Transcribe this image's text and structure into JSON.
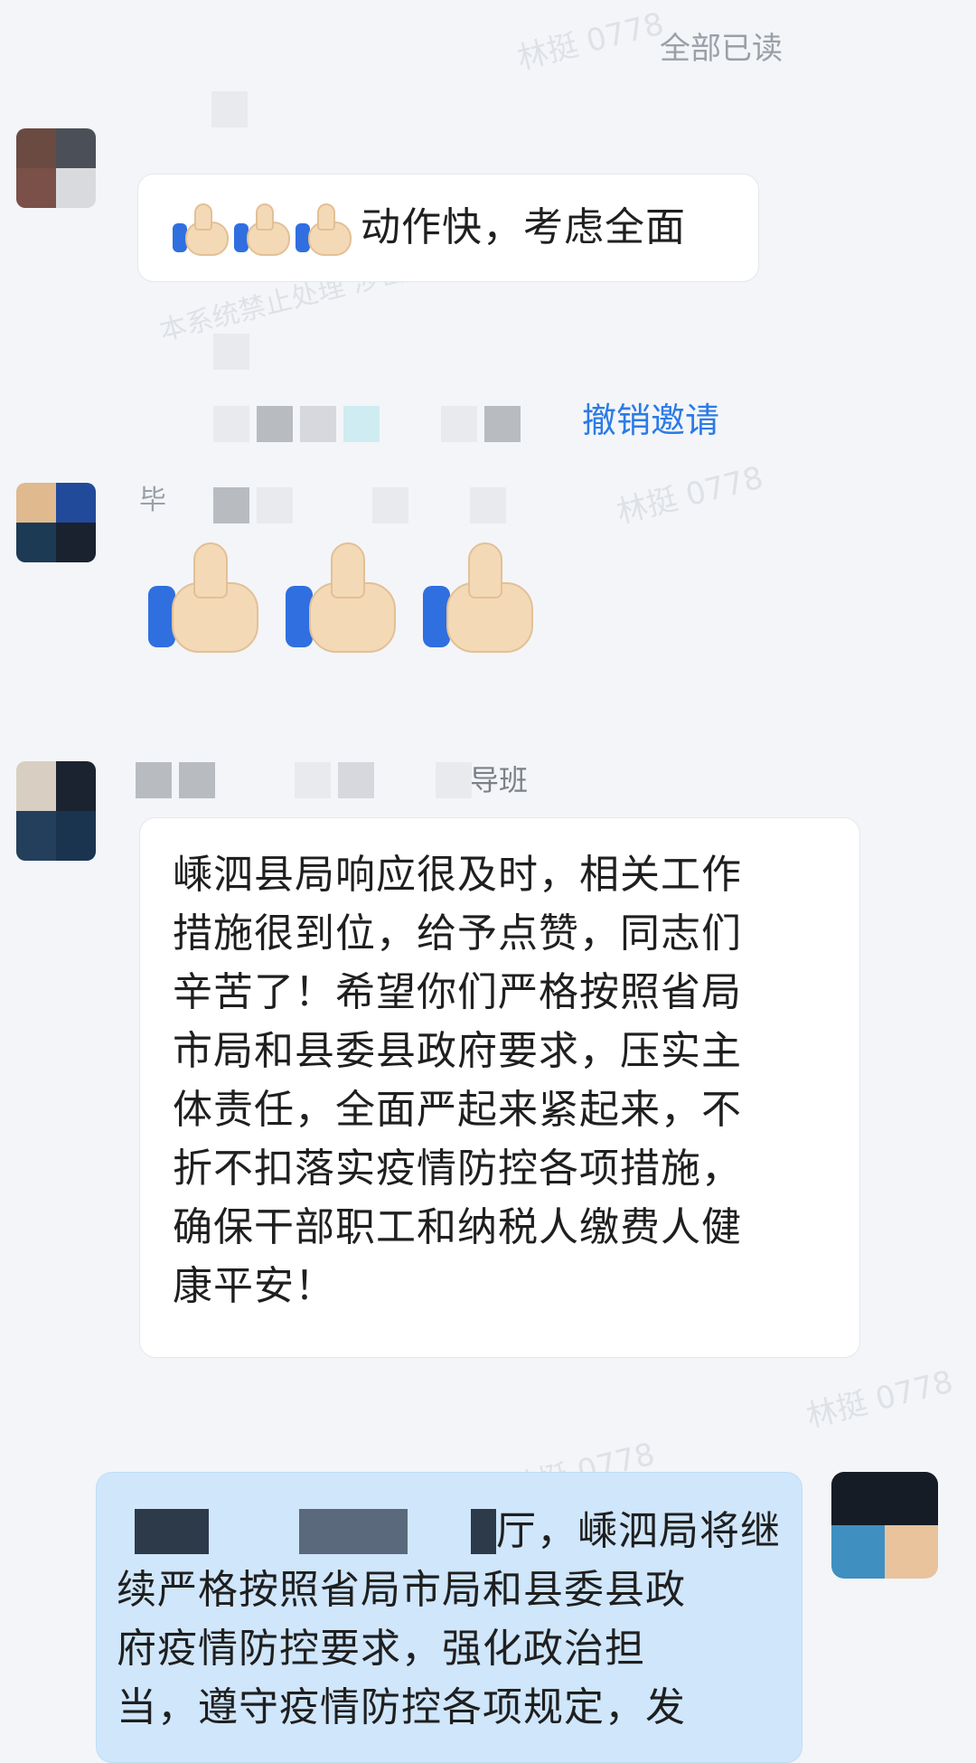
{
  "header": {
    "read_status": "全部已读"
  },
  "watermark": {
    "text": "林挺 0778",
    "fragment_text": "本系统禁止处理 涉密及敏感信息"
  },
  "messages": [
    {
      "id": "m1",
      "side": "left",
      "text": "动作快，考虑全面",
      "thumbs": 3
    },
    {
      "id": "m2",
      "side": "left",
      "action_link": "撤销邀请",
      "thumbs_big": 3,
      "sender_partial": "毕"
    },
    {
      "id": "m3",
      "side": "left",
      "sender_partial": "导班",
      "text": "嵊泗县局响应很及时，相关工作\n措施很到位，给予点赞，同志们\n辛苦了！希望你们严格按照省局\n市局和县委县政府要求，压实主\n体责任，全面严起来紧起来，不\n折不扣落实疫情防控各项措施，\n确保干部职工和纳税人缴费人健\n康平安！"
    },
    {
      "id": "m4",
      "side": "right",
      "text_line1": "厅，嵊泗局将继",
      "text_rest": "续严格按照省局市局和县委县政\n府疫情防控要求，强化政治担\n当，遵守疫情防控各项规定，发"
    }
  ],
  "colors": {
    "background": "#f3f5f8",
    "bubble_other": "#ffffff",
    "bubble_mine": "#cfe6fb",
    "link": "#2c7be5"
  },
  "icons": [
    "thumbs-up-icon"
  ]
}
